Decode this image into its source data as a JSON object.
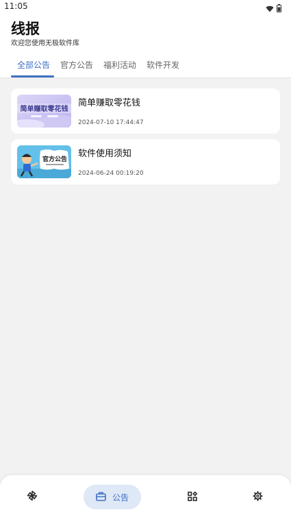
{
  "status_bar": {
    "time": "11:05",
    "icons": [
      "wifi-icon",
      "battery-icon"
    ]
  },
  "header": {
    "title": "线报",
    "subtitle": "欢迎您使用无极软件库"
  },
  "tabs": [
    {
      "label": "全部公告",
      "active": true
    },
    {
      "label": "官方公告",
      "active": false
    },
    {
      "label": "福利活动",
      "active": false
    },
    {
      "label": "软件开发",
      "active": false
    }
  ],
  "posts": [
    {
      "title": "简单赚取零花钱",
      "date": "2024-07-10 17:44:47",
      "thumb_text": "简单赚取零花钱"
    },
    {
      "title": "软件使用须知",
      "date": "2024-06-24 00:19:20",
      "thumb_text": "官方公告"
    }
  ],
  "bottom_nav": [
    {
      "icon": "pinwheel-icon",
      "label": "",
      "active": false
    },
    {
      "icon": "briefcase-icon",
      "label": "公告",
      "active": true
    },
    {
      "icon": "apps-grid-icon",
      "label": "",
      "active": false
    },
    {
      "icon": "gear-icon",
      "label": "",
      "active": false
    }
  ],
  "colors": {
    "accent": "#3e6fc4",
    "active_pill": "#dfe8f7",
    "background": "#f2f2f2",
    "card": "#ffffff"
  }
}
